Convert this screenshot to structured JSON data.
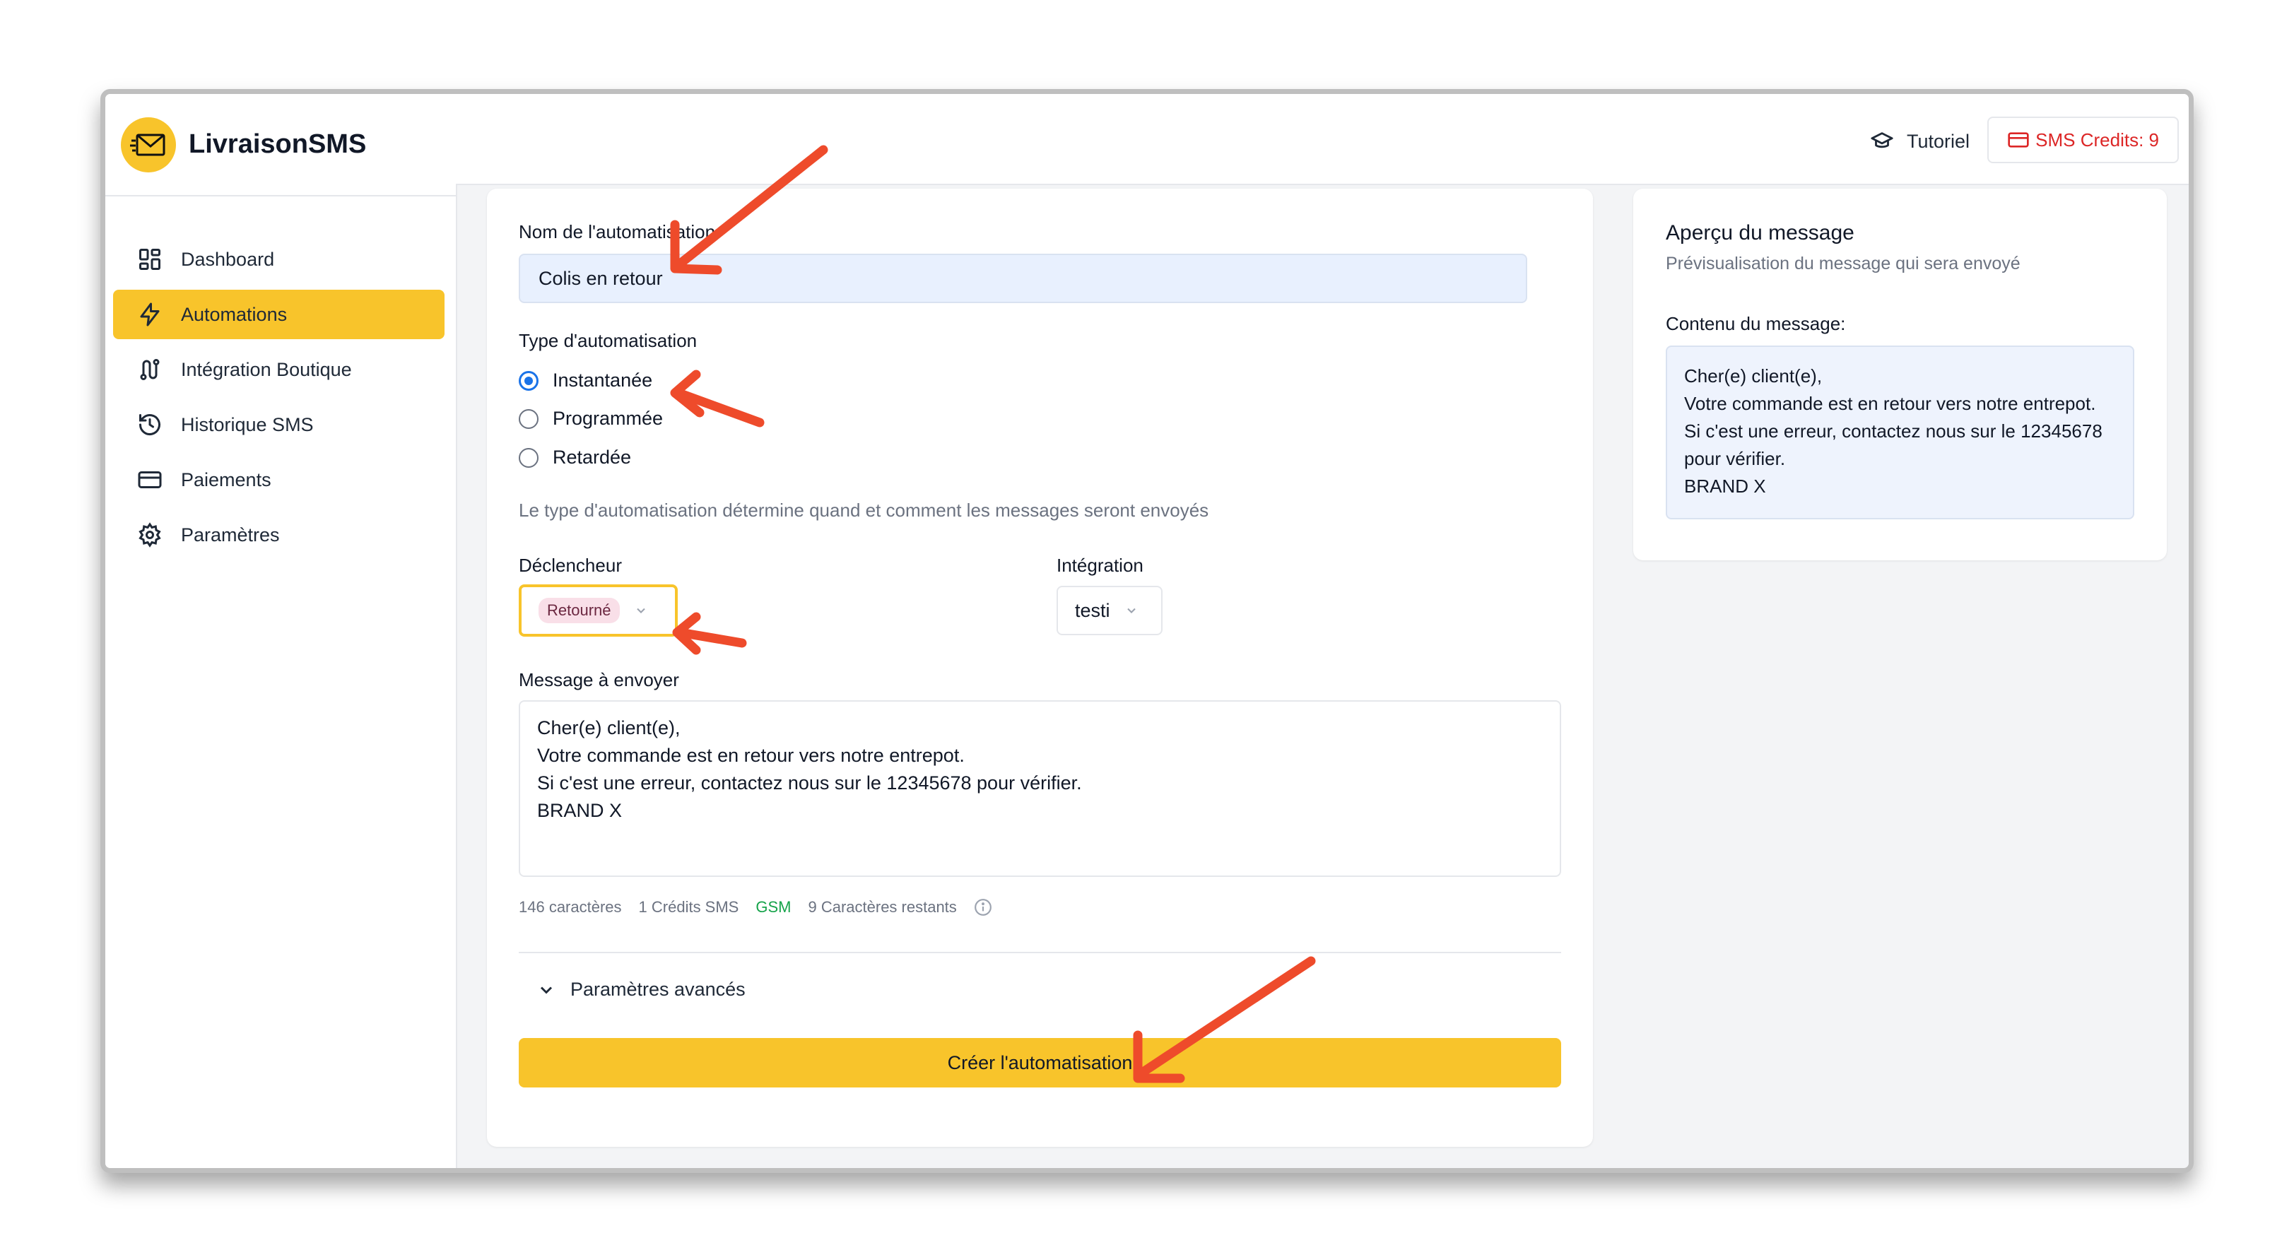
{
  "app": {
    "name": "LivraisonSMS"
  },
  "sidebar": {
    "items": [
      {
        "label": "Dashboard",
        "icon": "dashboard-icon"
      },
      {
        "label": "Automations",
        "icon": "bolt-icon",
        "active": true
      },
      {
        "label": "Intégration Boutique",
        "icon": "route-icon"
      },
      {
        "label": "Historique SMS",
        "icon": "history-icon"
      },
      {
        "label": "Paiements",
        "icon": "credit-card-icon"
      },
      {
        "label": "Paramètres",
        "icon": "gear-icon"
      }
    ]
  },
  "topbar": {
    "tutorial_label": "Tutoriel",
    "credits_label": "SMS Credits: 9"
  },
  "form": {
    "name_label": "Nom de l'automatisation",
    "name_value": "Colis en retour",
    "type_label": "Type d'automatisation",
    "types": [
      {
        "label": "Instantanée",
        "checked": true
      },
      {
        "label": "Programmée",
        "checked": false
      },
      {
        "label": "Retardée",
        "checked": false
      }
    ],
    "type_help": "Le type d'automatisation détermine quand et comment les messages seront envoyés",
    "trigger_label": "Déclencheur",
    "trigger_value": "Retourné",
    "integration_label": "Intégration",
    "integration_value": "testi",
    "message_label": "Message à envoyer",
    "message_value": "Cher(e) client(e),\nVotre commande est en retour vers notre entrepot.\nSi c'est une erreur, contactez nous sur le 12345678 pour vérifier.\nBRAND X",
    "stats": {
      "characters": "146 caractères",
      "credits": "1 Crédits SMS",
      "encoding": "GSM",
      "remaining": "9 Caractères restants"
    },
    "advanced_label": "Paramètres avancés",
    "submit_label": "Créer l'automatisation"
  },
  "preview": {
    "title": "Aperçu du message",
    "subtitle": "Prévisualisation du message qui sera envoyé",
    "content_label": "Contenu du message:",
    "content": "Cher(e) client(e),\nVotre commande est en retour vers notre entrepot.\nSi c'est une erreur, contactez nous sur le 12345678 pour vérifier.\nBRAND X"
  },
  "colors": {
    "accent": "#f8c42b",
    "annotation_arrow": "#ee4b2b",
    "credits_text": "#dc2626",
    "gsm_text": "#16a34a",
    "radio_checked": "#1a73e8"
  }
}
